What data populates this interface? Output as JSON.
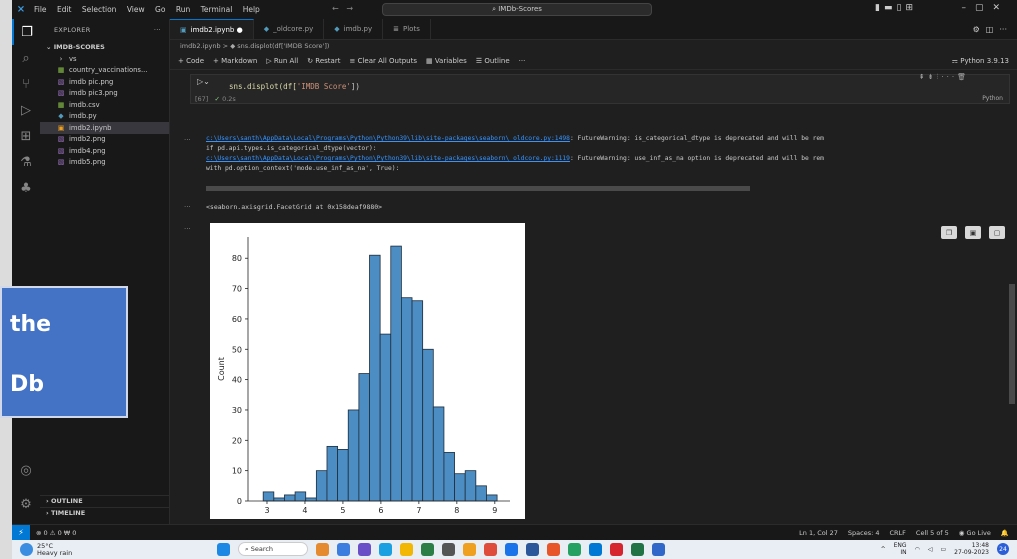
{
  "title_bar": {
    "menu": [
      "File",
      "Edit",
      "Selection",
      "View",
      "Go",
      "Run",
      "Terminal",
      "Help"
    ],
    "search": "IMDb-Scores",
    "back_icon": "arrow-left-icon",
    "forward_icon": "arrow-right-icon"
  },
  "sidebar": {
    "header": "EXPLORER",
    "folder": "IMDB-SCORES",
    "items": [
      {
        "label": "vs",
        "icon": "chevron-right-icon",
        "kind": "folder"
      },
      {
        "label": "country_vaccinations...",
        "icon": "csv-icon",
        "kind": "csv"
      },
      {
        "label": "imdb pic.png",
        "icon": "image-icon",
        "kind": "img"
      },
      {
        "label": "imdb pic3.png",
        "icon": "image-icon",
        "kind": "img"
      },
      {
        "label": "imdb.csv",
        "icon": "csv-icon",
        "kind": "csv"
      },
      {
        "label": "imdb.py",
        "icon": "python-icon",
        "kind": "py"
      },
      {
        "label": "imdb2.ipynb",
        "icon": "notebook-icon",
        "kind": "nb"
      },
      {
        "label": "imdb2.png",
        "icon": "image-icon",
        "kind": "img"
      },
      {
        "label": "imdb4.png",
        "icon": "image-icon",
        "kind": "img"
      },
      {
        "label": "imdb5.png",
        "icon": "image-icon",
        "kind": "img"
      }
    ],
    "outline": "OUTLINE",
    "timeline": "TIMELINE"
  },
  "tabs": [
    {
      "label": "imdb2.ipynb",
      "active": true,
      "modified": "●"
    },
    {
      "label": "_oldcore.py",
      "active": false
    },
    {
      "label": "imdb.py",
      "active": false
    },
    {
      "label": "Plots",
      "active": false
    }
  ],
  "breadcrumb": "imdb2.ipynb > ◆ sns.displot(df['IMDB Score'])",
  "toolbar": {
    "code": "+ Code",
    "markdown": "+ Markdown",
    "run_all": "Run All",
    "restart": "Restart",
    "clear": "Clear All Outputs",
    "variables": "Variables",
    "outline": "Outline",
    "more": "···",
    "kernel": "Python 3.9.13"
  },
  "cell": {
    "code_fn": "sns.displot(df[",
    "code_str": "'IMDB Score'",
    "code_end": "])",
    "exec_count": "[67]",
    "time": "0.2s",
    "lang": "Python"
  },
  "output": {
    "warn1_path": "c:\\Users\\santh\\AppData\\Local\\Programs\\Python\\Python39\\lib\\site-packages\\seaborn\\_oldcore.py:1498",
    "warn1_msg": ": FutureWarning: is_categorical_dtype is deprecated and will be rem",
    "warn1_line2": "  if pd.api.types.is_categorical_dtype(vector):",
    "warn2_path": "c:\\Users\\santh\\AppData\\Local\\Programs\\Python\\Python39\\lib\\site-packages\\seaborn\\_oldcore.py:1119",
    "warn2_msg": ": FutureWarning: use_inf_as_na option is deprecated and will be rem",
    "warn2_line2": "  with pd.option_context('mode.use_inf_as_na', True):",
    "facet": "<seaborn.axisgrid.FacetGrid at 0x158deaf9880>"
  },
  "chart_data": {
    "type": "bar",
    "xlabel": "",
    "ylabel": "Count",
    "xticks": [
      3,
      4,
      5,
      6,
      7,
      8,
      9
    ],
    "yticks": [
      0,
      10,
      20,
      30,
      40,
      50,
      60,
      70,
      80
    ],
    "xlim": [
      2.5,
      9.4
    ],
    "ylim": [
      0,
      87
    ],
    "bar_color": "#4c8dc4",
    "bins": [
      {
        "x0": 2.9,
        "x1": 3.18,
        "count": 3
      },
      {
        "x0": 3.18,
        "x1": 3.46,
        "count": 1
      },
      {
        "x0": 3.46,
        "x1": 3.74,
        "count": 2
      },
      {
        "x0": 3.74,
        "x1": 4.02,
        "count": 3
      },
      {
        "x0": 4.02,
        "x1": 4.3,
        "count": 1
      },
      {
        "x0": 4.3,
        "x1": 4.58,
        "count": 10
      },
      {
        "x0": 4.58,
        "x1": 4.86,
        "count": 18
      },
      {
        "x0": 4.86,
        "x1": 5.14,
        "count": 17
      },
      {
        "x0": 5.14,
        "x1": 5.42,
        "count": 30
      },
      {
        "x0": 5.42,
        "x1": 5.7,
        "count": 42
      },
      {
        "x0": 5.7,
        "x1": 5.98,
        "count": 81
      },
      {
        "x0": 5.98,
        "x1": 6.26,
        "count": 55
      },
      {
        "x0": 6.26,
        "x1": 6.54,
        "count": 84
      },
      {
        "x0": 6.54,
        "x1": 6.82,
        "count": 67
      },
      {
        "x0": 6.82,
        "x1": 7.1,
        "count": 66
      },
      {
        "x0": 7.1,
        "x1": 7.38,
        "count": 50
      },
      {
        "x0": 7.38,
        "x1": 7.66,
        "count": 31
      },
      {
        "x0": 7.66,
        "x1": 7.94,
        "count": 16
      },
      {
        "x0": 7.94,
        "x1": 8.22,
        "count": 9
      },
      {
        "x0": 8.22,
        "x1": 8.5,
        "count": 10
      },
      {
        "x0": 8.5,
        "x1": 8.78,
        "count": 5
      },
      {
        "x0": 8.78,
        "x1": 9.06,
        "count": 2
      }
    ]
  },
  "statusbar": {
    "left": "⊗ 0 ⚠ 0   ₩ 0",
    "ln_col": "Ln 1, Col 27",
    "spaces": "Spaces: 4",
    "eol": "CRLF",
    "cell": "Cell 5 of 5",
    "golive": "Go Live"
  },
  "taskbar": {
    "temp": "25°C",
    "weather": "Heavy rain",
    "search": "Search",
    "lang": "ENG",
    "region": "IN",
    "time": "13:48",
    "date": "27-09-2023",
    "badge": "24"
  },
  "callout": {
    "line1": "the",
    "line2": "Db",
    "bg": "#4472c4"
  }
}
